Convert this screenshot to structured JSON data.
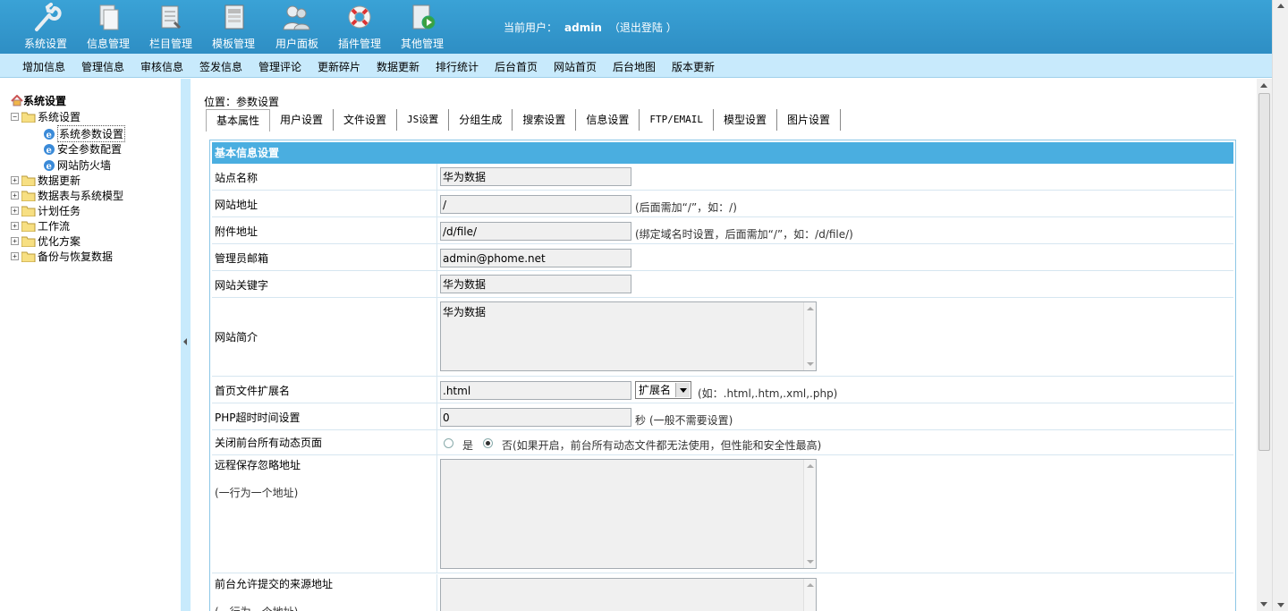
{
  "topnav": [
    {
      "label": "系统设置",
      "icon": "wrench-icon"
    },
    {
      "label": "信息管理",
      "icon": "documents-icon"
    },
    {
      "label": "栏目管理",
      "icon": "column-manage-icon"
    },
    {
      "label": "模板管理",
      "icon": "template-icon"
    },
    {
      "label": "用户面板",
      "icon": "users-icon"
    },
    {
      "label": "插件管理",
      "icon": "lifebuoy-icon"
    },
    {
      "label": "其他管理",
      "icon": "play-document-icon"
    }
  ],
  "user": {
    "prefix": "当前用户：",
    "name": "admin",
    "logout": "（退出登陆 ）"
  },
  "menu": [
    "增加信息",
    "管理信息",
    "审核信息",
    "签发信息",
    "管理评论",
    "更新碎片",
    "数据更新",
    "排行统计",
    "后台首页",
    "网站首页",
    "后台地图",
    "版本更新"
  ],
  "tree": {
    "root": "系统设置",
    "nodes": [
      {
        "label": "系统设置",
        "expanded": true,
        "children": [
          "系统参数设置",
          "安全参数配置",
          "网站防火墙"
        ]
      },
      {
        "label": "数据更新"
      },
      {
        "label": "数据表与系统模型"
      },
      {
        "label": "计划任务"
      },
      {
        "label": "工作流"
      },
      {
        "label": "优化方案"
      },
      {
        "label": "备份与恢复数据"
      }
    ]
  },
  "location": "位置：参数设置",
  "tabs": [
    "基本属性",
    "用户设置",
    "文件设置",
    "JS设置",
    "分组生成",
    "搜索设置",
    "信息设置",
    "FTP/EMAIL",
    "模型设置",
    "图片设置"
  ],
  "form": {
    "header": "基本信息设置",
    "site_name": {
      "label": "站点名称",
      "value": "华为数据"
    },
    "site_url": {
      "label": "网站地址",
      "value": "/",
      "hint": "(后面需加“/”，如：/)"
    },
    "attach_url": {
      "label": "附件地址",
      "value": "/d/file/",
      "hint": "(绑定域名时设置，后面需加“/”，如：/d/file/)"
    },
    "admin_email": {
      "label": "管理员邮箱",
      "value": "admin@phome.net"
    },
    "keywords": {
      "label": "网站关键字",
      "value": "华为数据"
    },
    "intro": {
      "label": "网站简介",
      "value": "华为数据"
    },
    "index_ext": {
      "label": "首页文件扩展名",
      "value": ".html",
      "select": "扩展名",
      "hint": "(如：.html,.htm,.xml,.php)"
    },
    "php_timeout": {
      "label": "PHP超时时间设置",
      "value": "0",
      "unit": "秒",
      "hint": "(一般不需要设置)"
    },
    "close_dynamic": {
      "label": "关闭前台所有动态页面",
      "yes": "是",
      "no": "否",
      "hint": "(如果开启，前台所有动态文件都无法使用，但性能和安全性最高)",
      "selected": "no"
    },
    "remote_ignore": {
      "label": "远程保存忽略地址",
      "sub": "(一行为一个地址)",
      "value": ""
    },
    "allowed_source": {
      "label": "前台允许提交的来源地址",
      "sub": "(一行为一个地址)",
      "value": ""
    }
  }
}
